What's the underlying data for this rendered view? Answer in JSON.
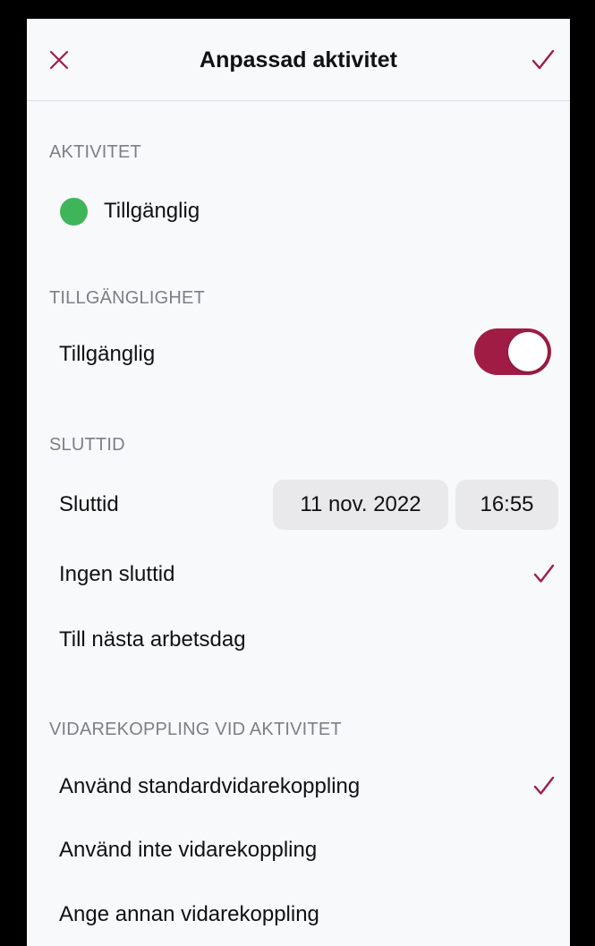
{
  "nav": {
    "title": "Anpassad aktivitet",
    "close_icon": "close-icon",
    "done_icon": "checkmark-icon",
    "accent_color": "#a11c45"
  },
  "activity": {
    "header": "AKTIVITET",
    "status_label": "Tillgänglig",
    "status_color": "#3fb55a"
  },
  "availability": {
    "header": "TILLGÄNGLIGHET",
    "label": "Tillgänglig",
    "toggle_on": true
  },
  "end_time": {
    "header": "SLUTTID",
    "label": "Sluttid",
    "date": "11 nov. 2022",
    "time": "16:55",
    "options": [
      {
        "label": "Ingen sluttid",
        "selected": true
      },
      {
        "label": "Till nästa arbetsdag",
        "selected": false
      }
    ]
  },
  "forwarding": {
    "header": "VIDAREKOPPLING VID AKTIVITET",
    "options": [
      {
        "label": "Använd standardvidarekoppling",
        "selected": true
      },
      {
        "label": "Använd inte vidarekoppling",
        "selected": false
      },
      {
        "label": "Ange annan vidarekoppling",
        "selected": false
      }
    ]
  }
}
